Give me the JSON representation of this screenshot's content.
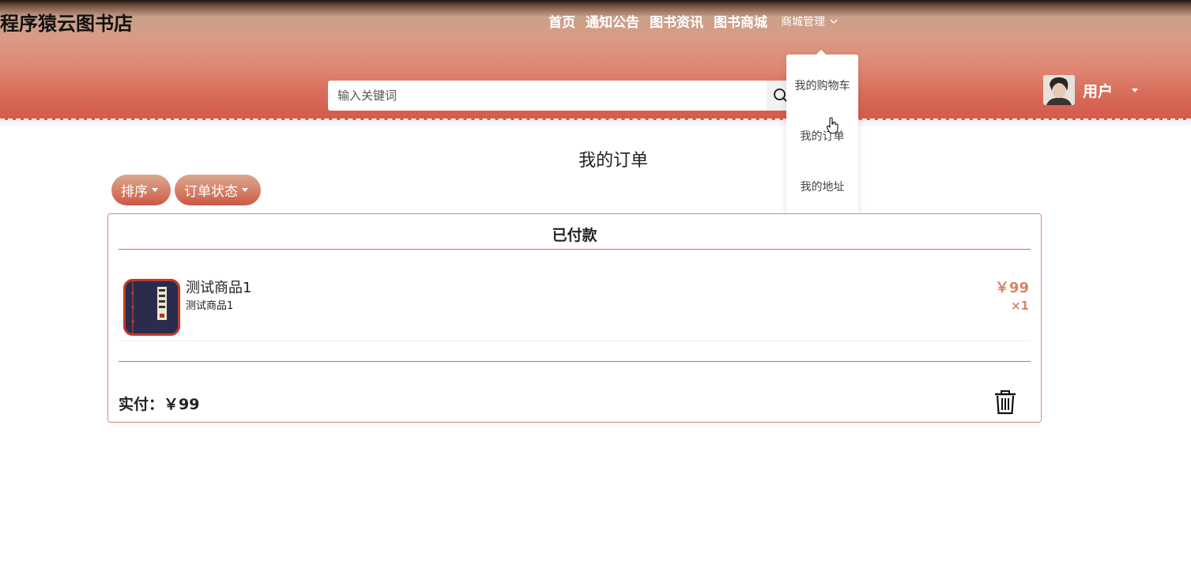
{
  "header": {
    "logo": "程序猿云图书店",
    "nav": [
      {
        "label": "首页"
      },
      {
        "label": "通知公告"
      },
      {
        "label": "图书资讯"
      },
      {
        "label": "图书商城"
      }
    ],
    "manage_label": "商城管理",
    "search": {
      "placeholder": "输入关键词",
      "value": ""
    },
    "user": {
      "name": "用户"
    }
  },
  "dropdown": {
    "items": [
      {
        "label": "我的购物车"
      },
      {
        "label": "我的订单"
      },
      {
        "label": "我的地址"
      }
    ]
  },
  "page": {
    "title": "我的订单",
    "filters": [
      {
        "label": "排序"
      },
      {
        "label": "订单状态"
      }
    ]
  },
  "order": {
    "status": "已付款",
    "items": [
      {
        "name": "测试商品1",
        "desc": "测试商品1",
        "price": "￥99",
        "qty": "×1"
      }
    ],
    "paid_label": "实付：￥99"
  },
  "colors": {
    "accent": "#d98363",
    "border": "#d8694f",
    "header_end": "#d45a4a"
  }
}
